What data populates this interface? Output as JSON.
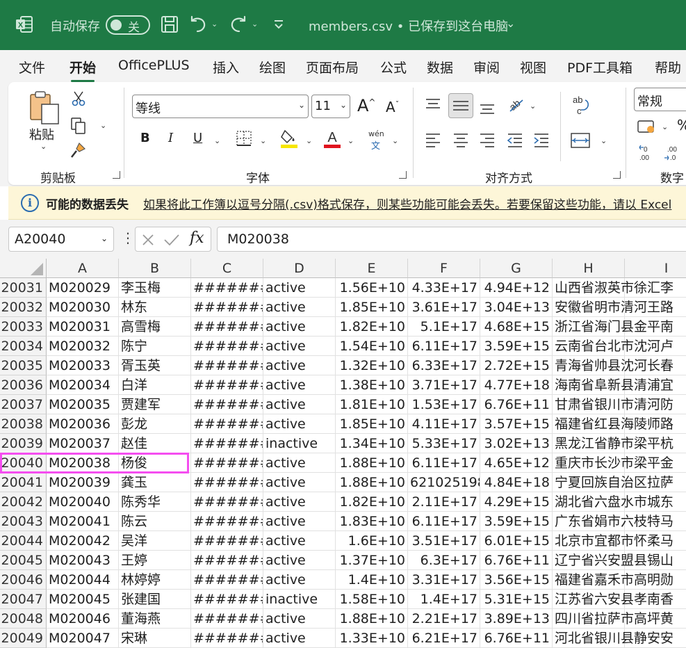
{
  "titlebar": {
    "autosave_label": "自动保存",
    "toggle_label": "关",
    "file_title": "members.csv • 已保存到这台电脑",
    "colors": {
      "bg": "#1e7a45",
      "fg": "#cfe7d9"
    }
  },
  "menu": {
    "tabs": [
      {
        "label": "文件",
        "active": false
      },
      {
        "label": "开始",
        "active": true
      },
      {
        "label": "OfficePLUS",
        "active": false
      },
      {
        "label": "插入",
        "active": false
      },
      {
        "label": "绘图",
        "active": false
      },
      {
        "label": "页面布局",
        "active": false
      },
      {
        "label": "公式",
        "active": false
      },
      {
        "label": "数据",
        "active": false
      },
      {
        "label": "审阅",
        "active": false
      },
      {
        "label": "视图",
        "active": false
      },
      {
        "label": "PDF工具箱",
        "active": false
      },
      {
        "label": "帮助",
        "active": false
      }
    ]
  },
  "ribbon": {
    "clipboard": {
      "paste_label": "粘贴",
      "group_label": "剪贴板"
    },
    "font": {
      "font_name": "等线",
      "font_size": "11",
      "group_label": "字体",
      "bold": "B",
      "italic": "I",
      "underline": "U",
      "phonetic_top": "wén",
      "phonetic_bottom": "文"
    },
    "alignment": {
      "group_label": "对齐方式"
    },
    "number": {
      "format": "常规",
      "group_label": "数字"
    }
  },
  "warning": {
    "title": "可能的数据丢失",
    "message": "如果将此工作簿以逗号分隔(.csv)格式保存，则某些功能可能会丢失。若要保留这些功能，请以 Excel"
  },
  "formula_bar": {
    "name_box": "A20040",
    "fx": "fx",
    "formula": "M020038"
  },
  "grid": {
    "columns": [
      "A",
      "B",
      "C",
      "D",
      "E",
      "F",
      "G",
      "H",
      "I"
    ],
    "rows": [
      {
        "num": "20031",
        "cells": [
          "M020029",
          "李玉梅",
          "#######",
          "active",
          "1.56E+10",
          "4.33E+17",
          "4.94E+12",
          "山西省淑英市徐汇李"
        ]
      },
      {
        "num": "20032",
        "cells": [
          "M020030",
          "林东",
          "#######",
          "active",
          "1.85E+10",
          "3.61E+17",
          "3.04E+13",
          "安徽省明市清河王路"
        ]
      },
      {
        "num": "20033",
        "cells": [
          "M020031",
          "高雪梅",
          "#######",
          "active",
          "1.82E+10",
          "5.1E+17",
          "4.68E+15",
          "浙江省海门县金平南"
        ]
      },
      {
        "num": "20034",
        "cells": [
          "M020032",
          "陈宁",
          "#######",
          "active",
          "1.54E+10",
          "6.11E+17",
          "3.59E+15",
          "云南省台北市沈河卢"
        ]
      },
      {
        "num": "20035",
        "cells": [
          "M020033",
          "胥玉英",
          "#######",
          "active",
          "1.32E+10",
          "6.33E+17",
          "2.72E+15",
          "青海省帅县沈河长春"
        ]
      },
      {
        "num": "20036",
        "cells": [
          "M020034",
          "白洋",
          "#######",
          "active",
          "1.38E+10",
          "3.71E+17",
          "4.77E+18",
          "海南省阜新县清浦宜"
        ]
      },
      {
        "num": "20037",
        "cells": [
          "M020035",
          "贾建军",
          "#######",
          "active",
          "1.81E+10",
          "1.53E+17",
          "6.76E+11",
          "甘肃省银川市清河防"
        ]
      },
      {
        "num": "20038",
        "cells": [
          "M020036",
          "彭龙",
          "#######",
          "active",
          "1.85E+10",
          "4.11E+17",
          "3.57E+15",
          "福建省红县海陵师路"
        ]
      },
      {
        "num": "20039",
        "cells": [
          "M020037",
          "赵佳",
          "#######",
          "inactive",
          "1.34E+10",
          "5.33E+17",
          "3.02E+13",
          "黑龙江省静市梁平杭"
        ]
      },
      {
        "num": "20040",
        "cells": [
          "M020038",
          "杨俊",
          "#######",
          "active",
          "1.88E+10",
          "6.11E+17",
          "4.65E+12",
          "重庆市长沙市梁平金"
        ]
      },
      {
        "num": "20041",
        "cells": [
          "M020039",
          "龚玉",
          "#######",
          "active",
          "1.88E+10",
          "621025198",
          "4.84E+18",
          "宁夏回族自治区拉萨"
        ]
      },
      {
        "num": "20042",
        "cells": [
          "M020040",
          "陈秀华",
          "#######",
          "active",
          "1.82E+10",
          "2.11E+17",
          "4.29E+15",
          "湖北省六盘水市城东"
        ]
      },
      {
        "num": "20043",
        "cells": [
          "M020041",
          "陈云",
          "#######",
          "active",
          "1.83E+10",
          "6.11E+17",
          "3.59E+15",
          "广东省娟市六枝特马"
        ]
      },
      {
        "num": "20044",
        "cells": [
          "M020042",
          "吴洋",
          "#######",
          "active",
          "1.6E+10",
          "3.51E+17",
          "6.01E+15",
          "北京市宜都市怀柔马"
        ]
      },
      {
        "num": "20045",
        "cells": [
          "M020043",
          "王婷",
          "#######",
          "active",
          "1.37E+10",
          "6.3E+17",
          "6.76E+11",
          "辽宁省兴安盟县锡山"
        ]
      },
      {
        "num": "20046",
        "cells": [
          "M020044",
          "林婷婷",
          "#######",
          "active",
          "1.4E+10",
          "3.31E+17",
          "3.56E+15",
          "福建省嘉禾市高明勋"
        ]
      },
      {
        "num": "20047",
        "cells": [
          "M020045",
          "张建国",
          "#######",
          "inactive",
          "1.58E+10",
          "1.4E+17",
          "5.31E+15",
          "江苏省六安县孝南香"
        ]
      },
      {
        "num": "20048",
        "cells": [
          "M020046",
          "董海燕",
          "#######",
          "active",
          "1.88E+10",
          "2.21E+17",
          "3.89E+13",
          "四川省拉萨市高坪黄"
        ]
      },
      {
        "num": "20049",
        "cells": [
          "M020047",
          "宋琳",
          "#######",
          "active",
          "1.33E+10",
          "6.21E+17",
          "6.76E+11",
          "河北省银川县静安安"
        ]
      }
    ],
    "selected_row_index": 9,
    "selection_color": "#f54ef0"
  }
}
